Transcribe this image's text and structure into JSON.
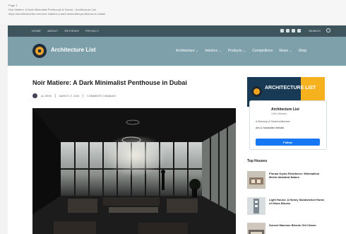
{
  "print_header": {
    "line1": "Page 1",
    "line2": "Noir Matiere: A Dark Minimalist Penthouse in Dubai – Architecture List",
    "line3": "https://architecturelist.com/noir-matiere-a-dark-minimalist-penthouse-in-dubai/"
  },
  "topbar": {
    "nav": [
      "HOME",
      "ABOUT",
      "REVIEWS",
      "PRIVACY"
    ],
    "search_label": "SEARCH"
  },
  "header": {
    "site_name": "Architecture List",
    "nav": [
      "Architecture ⌄",
      "Interiors ⌄",
      "Products ⌄",
      "Competitions",
      "News ⌄",
      "Shop"
    ]
  },
  "article": {
    "title": "Noir Matiere: A Dark Minimalist Penthouse in Dubai",
    "author": "AL DESK",
    "date": "MARCH 17, 2025",
    "comments": "COMMENTS: DISABLED"
  },
  "sidebar": {
    "banner_text": "ARCHITECTURE LIST",
    "page_card": {
      "name": "Architecture List",
      "followers": "100K followers",
      "description": "A Directory of Great Architecture",
      "line": "Arts & Humanities Website"
    },
    "follow_label": "Follow",
    "top_houses_title": "Top Houses",
    "top_houses": [
      "Pinnau Kyoto Residence: Minimalism Meets Idealized Nature",
      "Light House: A Honey Sandwiched Home of Glass Blocks",
      "Sunset Mansion Blends Old Charm"
    ]
  }
}
